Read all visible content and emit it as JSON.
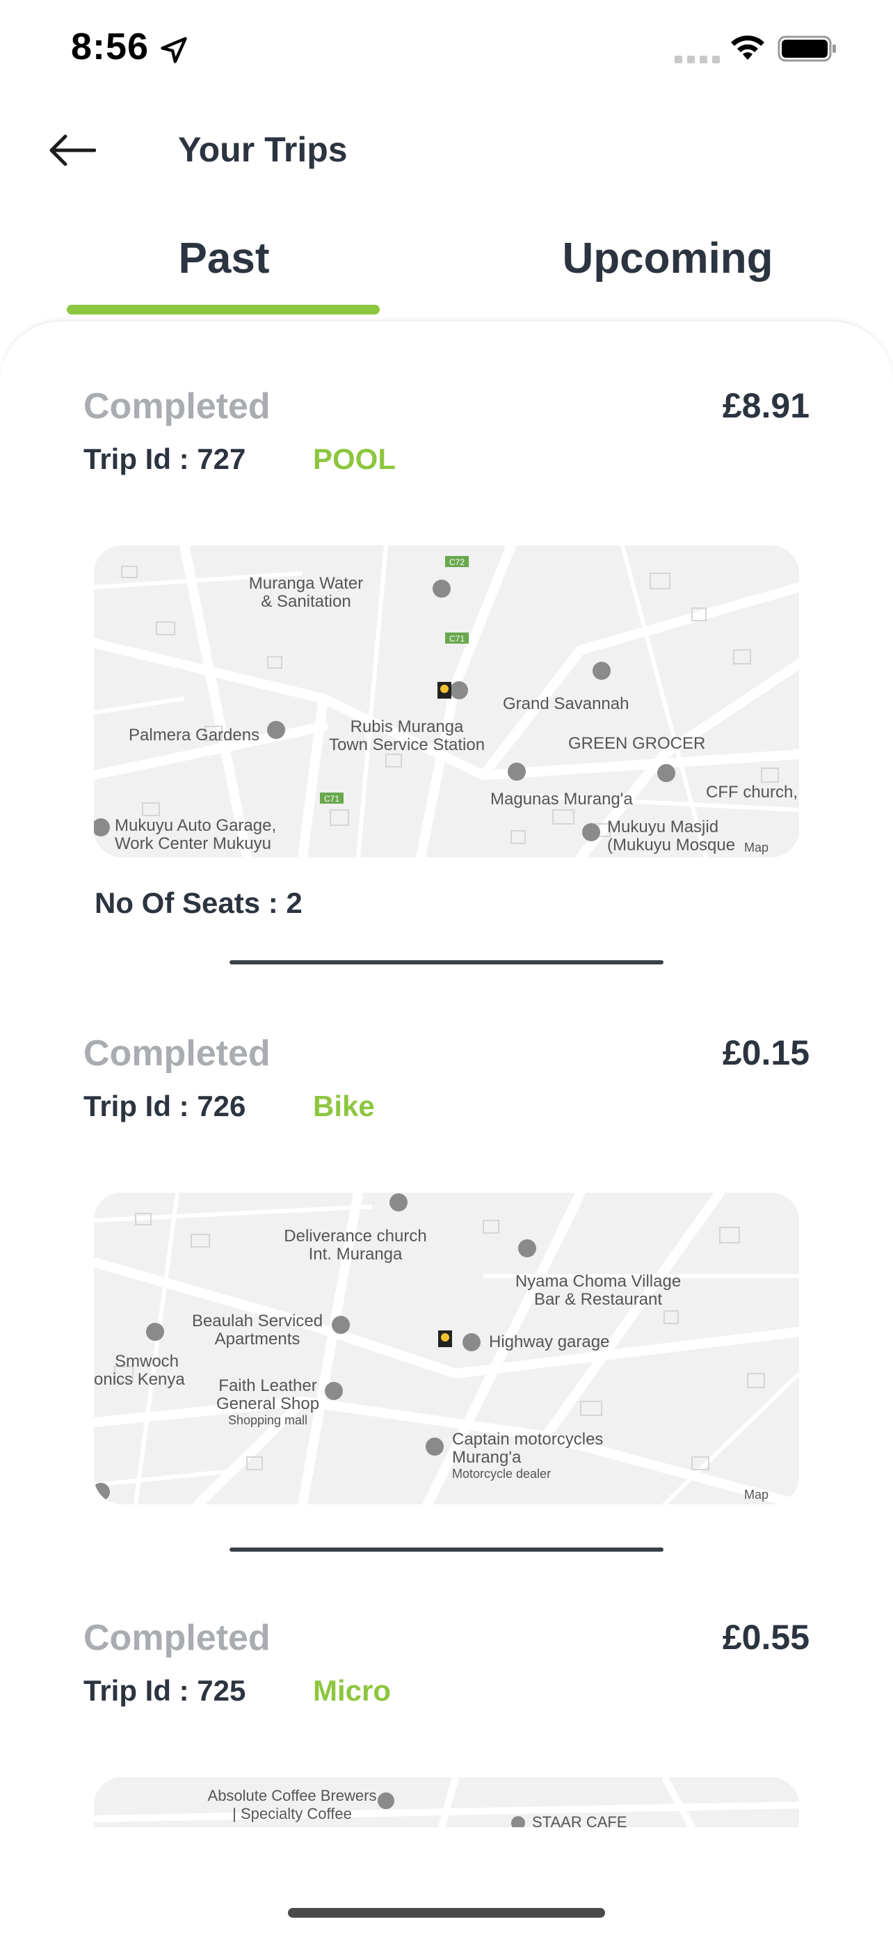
{
  "status_bar": {
    "time": "8:56",
    "icons": [
      "location-arrow-icon",
      "cellular-signal-icon",
      "wifi-icon",
      "battery-icon"
    ]
  },
  "header": {
    "title": "Your Trips",
    "back_icon": "arrow-left-icon"
  },
  "tabs": [
    {
      "label": "Past",
      "active": true
    },
    {
      "label": "Upcoming",
      "active": false
    }
  ],
  "colors": {
    "accent": "#8dc63f",
    "text_dark": "#2c3440",
    "text_muted": "#a9acb0",
    "map_bg": "#f1f1f1"
  },
  "trips": [
    {
      "status": "Completed",
      "price": "£8.91",
      "trip_id": "Trip Id : 727",
      "type": "POOL",
      "seats": "No Of Seats : 2",
      "map_labels": [
        "Muranga Water",
        "& Sanitation",
        "C72",
        "C71",
        "Grand Savannah",
        "Palmera Gardens",
        "Rubis Muranga",
        "Town Service Station",
        "GREEN GROCER",
        "CFF church,",
        "Magunas Murang'a",
        "Mukuyu Auto Garage,",
        "Work Center Mukuyu",
        "Mukuyu Masjid",
        "(Mukuyu Mosque",
        "Map"
      ]
    },
    {
      "status": "Completed",
      "price": "£0.15",
      "trip_id": "Trip Id : 726",
      "type": "Bike",
      "map_labels": [
        "Deliverance church",
        "Int. Muranga",
        "Nyama Choma Village",
        "Bar & Restaurant",
        "Beaulah Serviced",
        "Apartments",
        "Highway garage",
        "Smwoch",
        "onics Kenya",
        "Faith Leather",
        "General Shop",
        "Shopping mall",
        "Captain motorcycles",
        "Murang'a",
        "Motorcycle dealer",
        "Map"
      ]
    },
    {
      "status": "Completed",
      "price": "£0.55",
      "trip_id": "Trip Id : 725",
      "type": "Micro",
      "map_labels": [
        "Absolute Coffee Brewers",
        "| Specialty Coffee",
        "STAAR CAFE"
      ]
    }
  ]
}
